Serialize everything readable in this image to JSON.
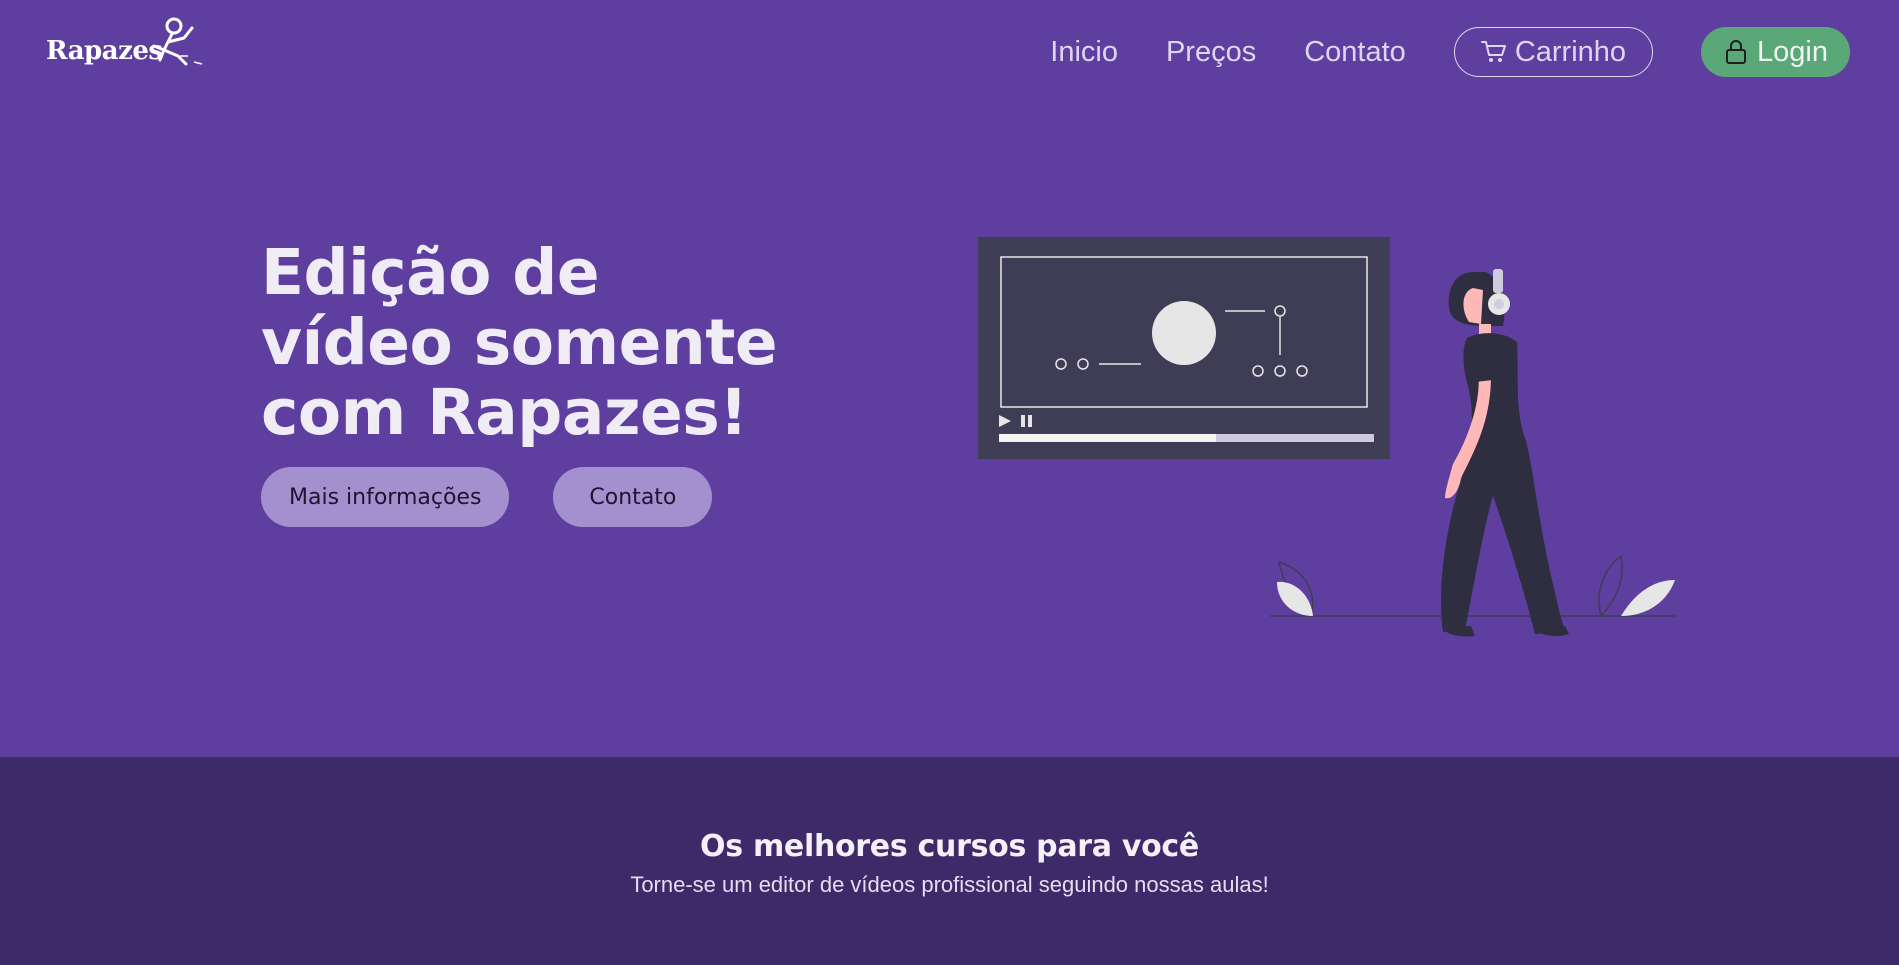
{
  "header": {
    "logo_text": "Rapazes",
    "nav": {
      "inicio": "Inicio",
      "precos": "Preços",
      "contato": "Contato",
      "cart_label": "Carrinho",
      "login_label": "Login"
    }
  },
  "hero": {
    "title_line1": "Edição de",
    "title_line2": "vídeo somente",
    "title_line3": "com Rapazes!",
    "button_more": "Mais informações",
    "button_contact": "Contato"
  },
  "illustration": {
    "player_progress": 0.58
  },
  "courses": {
    "title": "Os melhores cursos para você",
    "subtitle": "Torne-se um editor de vídeos profissional seguindo nossas aulas!"
  },
  "colors": {
    "background": "#5e3fa0",
    "section_dark": "#3d2a69",
    "login_green": "#5aa877",
    "hero_button": "#a48fcf"
  }
}
